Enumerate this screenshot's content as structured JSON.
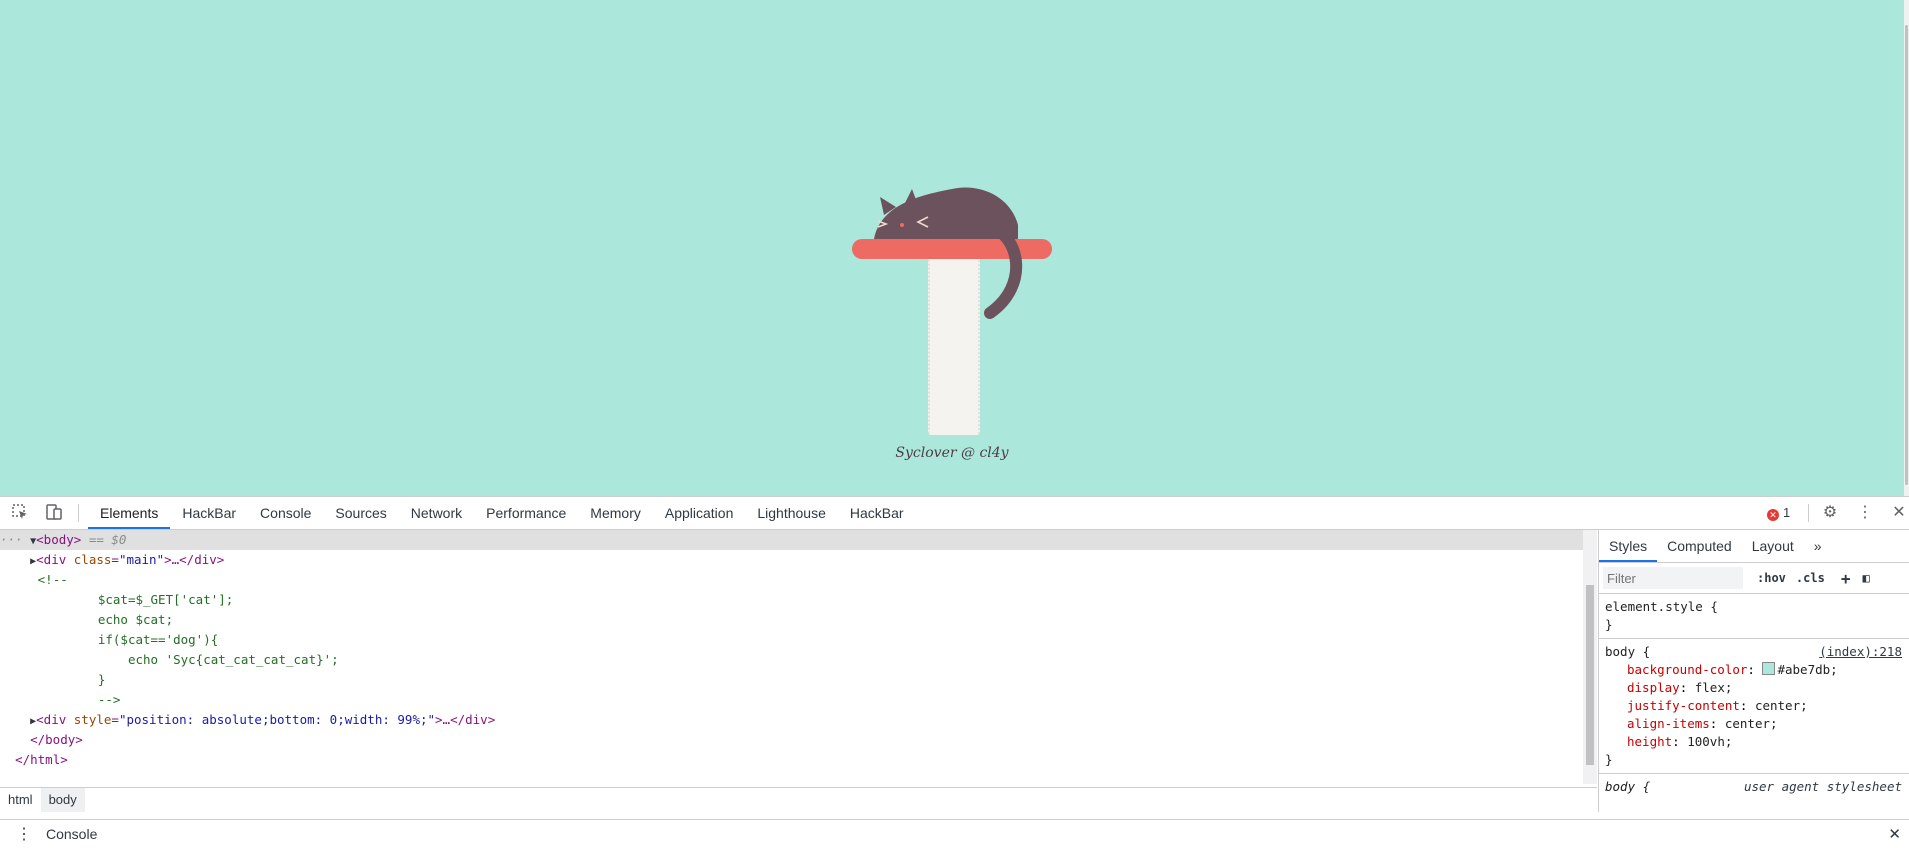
{
  "page": {
    "background": "#abe7db",
    "credit": "Syclover @ cl4y"
  },
  "devtools": {
    "tabs": [
      {
        "label": "Elements",
        "active": true
      },
      {
        "label": "HackBar"
      },
      {
        "label": "Console"
      },
      {
        "label": "Sources"
      },
      {
        "label": "Network"
      },
      {
        "label": "Performance"
      },
      {
        "label": "Memory"
      },
      {
        "label": "Application"
      },
      {
        "label": "Lighthouse"
      },
      {
        "label": "HackBar"
      }
    ],
    "error_count": "1",
    "icons": {
      "inspect": "inspect-icon",
      "device": "device-toolbar-icon",
      "settings": "gear-icon",
      "more": "kebab-menu-icon",
      "close": "close-icon"
    },
    "elements": {
      "body_line": {
        "tag": "<body>",
        "marker": " == $0"
      },
      "main_div": {
        "open": "<div ",
        "attr": "class",
        "val": "\"main\"",
        "rest": ">…</div>"
      },
      "comment_lines": [
        "<!--",
        "        $cat=$_GET['cat'];",
        "        echo $cat;",
        "        if($cat=='dog'){",
        "            echo 'Syc{cat_cat_cat_cat}';",
        "        }",
        "        -->"
      ],
      "style_div": {
        "open": "<div ",
        "attr": "style",
        "val": "\"position: absolute;bottom: 0;width: 99%;\"",
        "rest": ">…</div>"
      },
      "close_body": "</body>",
      "close_html": "</html>"
    },
    "breadcrumb": [
      "html",
      "body"
    ],
    "styles": {
      "tabs": [
        "Styles",
        "Computed",
        "Layout"
      ],
      "filter_placeholder": "Filter",
      "hov": ":hov",
      "cls": ".cls",
      "element_style": "element.style {",
      "close_brace": "}",
      "body_selector": "body {",
      "body_source": "(index):218",
      "declarations": [
        {
          "prop": "background-color",
          "val": "#abe7db;"
        },
        {
          "prop": "display",
          "val": "flex;"
        },
        {
          "prop": "justify-content",
          "val": "center;"
        },
        {
          "prop": "align-items",
          "val": "center;"
        },
        {
          "prop": "height",
          "val": "100vh;"
        }
      ],
      "ua_selector": "body {",
      "ua_source": "user agent stylesheet"
    },
    "drawer": {
      "label": "Console"
    }
  }
}
